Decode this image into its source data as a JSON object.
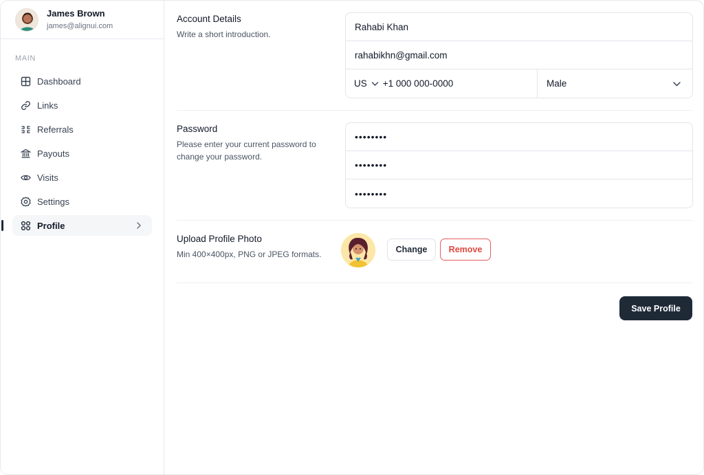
{
  "user": {
    "name": "James Brown",
    "email": "james@alignui.com",
    "avatar_icon": "user-avatar"
  },
  "sidebar": {
    "section_label": "MAIN",
    "items": [
      {
        "label": "Dashboard",
        "icon": "grid-icon"
      },
      {
        "label": "Links",
        "icon": "link-icon"
      },
      {
        "label": "Referrals",
        "icon": "referrals-icon"
      },
      {
        "label": "Payouts",
        "icon": "bank-icon"
      },
      {
        "label": "Visits",
        "icon": "eye-icon"
      },
      {
        "label": "Settings",
        "icon": "gear-icon"
      },
      {
        "label": "Profile",
        "icon": "apps-icon",
        "active": true
      }
    ]
  },
  "account": {
    "title": "Account Details",
    "description": "Write a short introduction.",
    "name_value": "Rahabi Khan",
    "email_value": "rahabikhn@gmail.com",
    "country_code": "US",
    "phone_value": "+1 000 000-0000",
    "gender_value": "Male"
  },
  "password": {
    "title": "Password",
    "description": "Please enter your current password to change your password.",
    "fields": [
      "••••••••",
      "••••••••",
      "••••••••"
    ]
  },
  "photo": {
    "title": "Upload Profile Photo",
    "description": "Min 400×400px, PNG or JPEG formats.",
    "change_label": "Change",
    "remove_label": "Remove"
  },
  "actions": {
    "save_label": "Save Profile"
  },
  "colors": {
    "primary_button": "#1f2a37",
    "danger": "#e0473e",
    "active_bg": "#f5f6f8"
  }
}
